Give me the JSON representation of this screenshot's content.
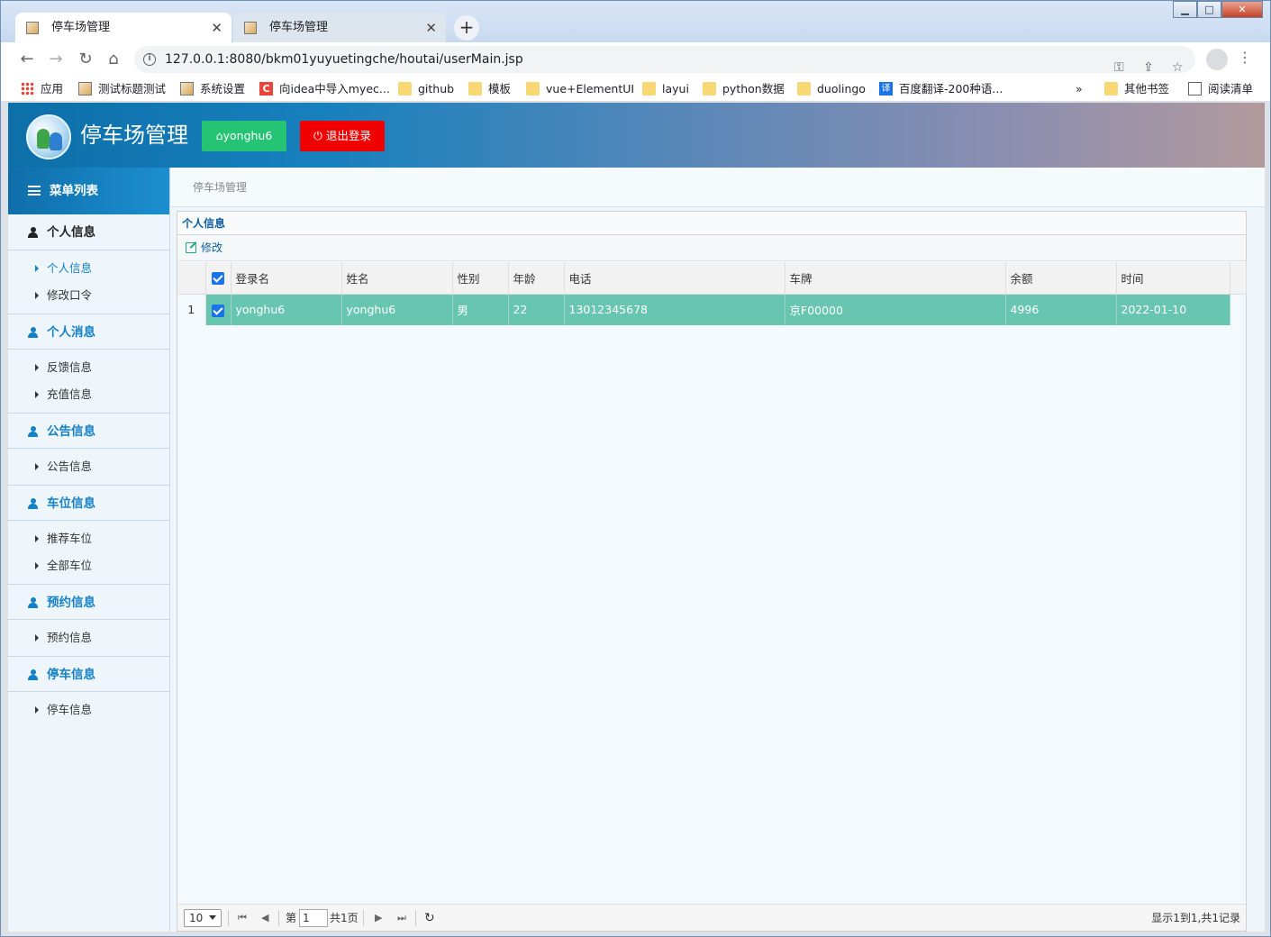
{
  "browser": {
    "tabs": [
      {
        "title": "停车场管理",
        "active": true
      },
      {
        "title": "停车场管理",
        "active": false
      }
    ],
    "url": "127.0.0.1:8080/bkm01yuyuetingche/houtai/userMain.jsp",
    "bookmarks": [
      {
        "label": "应用",
        "icon": "apps-icon"
      },
      {
        "label": "测试标题测试",
        "icon": "page-icon"
      },
      {
        "label": "系统设置",
        "icon": "page-icon"
      },
      {
        "label": "向idea中导入myec...",
        "icon": "c-icon"
      },
      {
        "label": "github",
        "icon": "folder-icon"
      },
      {
        "label": "模板",
        "icon": "folder-icon"
      },
      {
        "label": "vue+ElementUI",
        "icon": "folder-icon"
      },
      {
        "label": "layui",
        "icon": "folder-icon"
      },
      {
        "label": "python数据",
        "icon": "folder-icon"
      },
      {
        "label": "duolingo",
        "icon": "folder-icon"
      },
      {
        "label": "百度翻译-200种语...",
        "icon": "translate-icon"
      }
    ],
    "bookmark_overflow": "»",
    "other_bookmarks": "其他书签",
    "reading_list": "阅读清单",
    "translate_glyph": "译",
    "c_glyph": "C"
  },
  "header": {
    "brand": "停车场管理",
    "user_button": "yonghu6",
    "logout_button": "退出登录"
  },
  "sidebar": {
    "title": "菜单列表",
    "groups": [
      {
        "label": "个人信息",
        "items": [
          "个人信息",
          "修改口令"
        ]
      },
      {
        "label": "个人消息",
        "items": [
          "反馈信息",
          "充值信息"
        ]
      },
      {
        "label": "公告信息",
        "items": [
          "公告信息"
        ]
      },
      {
        "label": "车位信息",
        "items": [
          "推荐车位",
          "全部车位"
        ]
      },
      {
        "label": "预约信息",
        "items": [
          "预约信息"
        ]
      },
      {
        "label": "停车信息",
        "items": [
          "停车信息"
        ]
      }
    ]
  },
  "breadcrumb": "停车场管理",
  "panel": {
    "title": "个人信息",
    "edit_label": "修改"
  },
  "table": {
    "columns": [
      "登录名",
      "姓名",
      "性别",
      "年龄",
      "电话",
      "车牌",
      "余额",
      "时间"
    ],
    "rows": [
      {
        "num": "1",
        "cells": [
          "yonghu6",
          "yonghu6",
          "男",
          "22",
          "13012345678",
          "京F00000",
          "4996",
          "2022-01-10"
        ]
      }
    ]
  },
  "pager": {
    "page_size": "10",
    "page_prefix": "第",
    "page_value": "1",
    "page_total": "共1页",
    "info": "显示1到1,共1记录"
  },
  "colors": {
    "selected_row": "#67c5b0",
    "user_button": "#24c474",
    "logout_button": "#f00000",
    "menu_accent": "#1581c5"
  }
}
